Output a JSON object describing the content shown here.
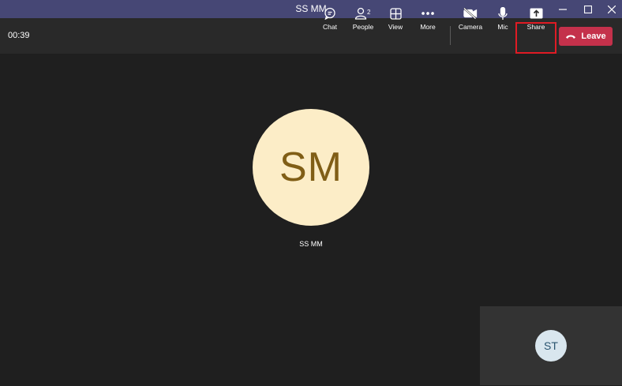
{
  "window": {
    "title": "SS MM"
  },
  "toolbar": {
    "timer": "00:39",
    "chat": "Chat",
    "people": "People",
    "people_count": "2",
    "view": "View",
    "more": "More",
    "camera": "Camera",
    "mic": "Mic",
    "share": "Share",
    "leave": "Leave"
  },
  "participant": {
    "initials": "SM",
    "name": "SS MM"
  },
  "self": {
    "initials": "ST"
  },
  "colors": {
    "titlebar": "#464775",
    "toolbar": "#292929",
    "stage": "#1f1f1f",
    "leave": "#c4314b",
    "highlight": "#e01b24",
    "avatar_main_bg": "#fcedc7",
    "avatar_main_fg": "#805e16"
  }
}
